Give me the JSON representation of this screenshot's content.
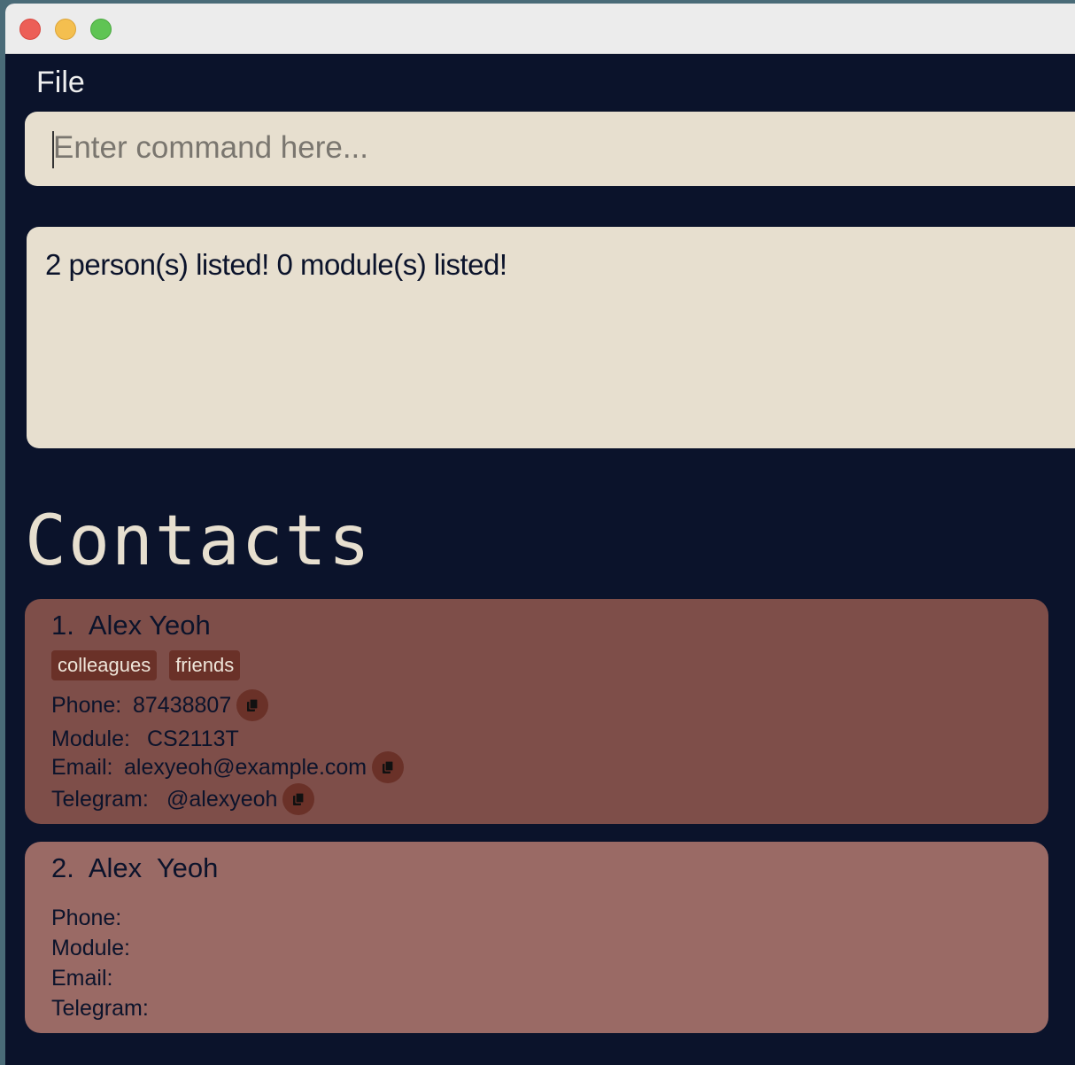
{
  "menu": {
    "file": "File"
  },
  "command": {
    "placeholder": "Enter command here..."
  },
  "result": {
    "text": "2 person(s) listed! 0 module(s) listed!"
  },
  "contacts": {
    "heading": "Contacts",
    "people": [
      {
        "index": "1.",
        "name": "Alex Yeoh",
        "tags": [
          "colleagues",
          "friends"
        ],
        "phone_label": "Phone:",
        "phone": "87438807",
        "module_label": "Module:",
        "module": "CS2113T",
        "email_label": "Email:",
        "email": "alexyeoh@example.com",
        "telegram_label": "Telegram:",
        "telegram": "@alexyeoh"
      },
      {
        "index": "2.",
        "name": "Alex  Yeoh",
        "phone_label": "Phone:",
        "module_label": "Module:",
        "email_label": "Email:",
        "telegram_label": "Telegram:"
      }
    ]
  },
  "colors": {
    "background": "#0b132b",
    "panel": "#e7dfcf",
    "card_selected": "#7e4e49",
    "card": "#9a6a65",
    "tag": "#6a3128"
  },
  "icons": {
    "copy": "copy-icon"
  }
}
